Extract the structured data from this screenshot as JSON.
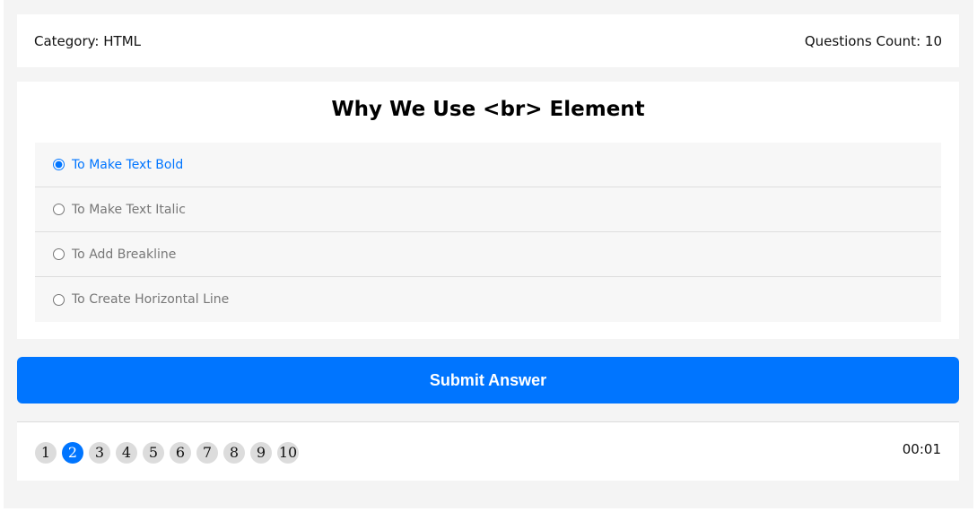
{
  "info": {
    "category_label": "Category:",
    "category_value": "HTML",
    "count_label": "Questions Count:",
    "count_value": "10"
  },
  "question": {
    "title": "Why We Use <br> Element",
    "answers": [
      {
        "label": "To Make Text Bold",
        "selected": true
      },
      {
        "label": "To Make Text Italic",
        "selected": false
      },
      {
        "label": "To Add Breakline",
        "selected": false
      },
      {
        "label": "To Create Horizontal Line",
        "selected": false
      }
    ]
  },
  "submit_label": "Submit Answer",
  "bullets": [
    "1",
    "2",
    "3",
    "4",
    "5",
    "6",
    "7",
    "8",
    "9",
    "10"
  ],
  "active_bullet": "2",
  "timer": "00:01",
  "colors": {
    "accent": "#0075ff",
    "bullet_inactive": "#dcdcdc",
    "page_background": "#f4f4f4"
  }
}
